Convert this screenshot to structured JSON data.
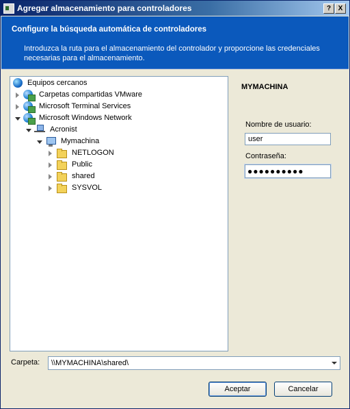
{
  "window": {
    "title": "Agregar almacenamiento para controladores",
    "help_label": "?",
    "close_label": "X"
  },
  "header": {
    "title": "Configure la búsqueda automática de controladores",
    "description": "Introduzca la ruta para el almacenamiento del controlador y proporcione las credenciales necesarias para el almacenamiento."
  },
  "tree": {
    "items": [
      {
        "label": "Equipos cercanos",
        "icon": "globe-icon",
        "expander": "none"
      },
      {
        "label": "Carpetas compartidas VMware",
        "icon": "network-globe-icon",
        "expander": "collapsed"
      },
      {
        "label": "Microsoft Terminal Services",
        "icon": "network-globe-icon",
        "expander": "collapsed"
      },
      {
        "label": "Microsoft Windows Network",
        "icon": "network-globe-icon",
        "expander": "expanded"
      },
      {
        "label": "Acronist",
        "icon": "workgroup-icon",
        "expander": "expanded"
      },
      {
        "label": "Mymachina",
        "icon": "computer-icon",
        "expander": "expanded"
      },
      {
        "label": "NETLOGON",
        "icon": "shared-folder-icon",
        "expander": "collapsed"
      },
      {
        "label": "Public",
        "icon": "shared-folder-icon",
        "expander": "collapsed"
      },
      {
        "label": "shared",
        "icon": "shared-folder-icon",
        "expander": "collapsed"
      },
      {
        "label": "SYSVOL",
        "icon": "shared-folder-icon",
        "expander": "collapsed"
      }
    ]
  },
  "credentials": {
    "machine_name": "MYMACHINA",
    "username_label": "Nombre de usuario:",
    "username_value": "user",
    "password_label": "Contraseña:",
    "password_mask": "●●●●●●●●●●"
  },
  "path": {
    "label": "Carpeta:",
    "value": "\\\\MYMACHINA\\shared\\"
  },
  "buttons": {
    "ok": "Aceptar",
    "cancel": "Cancelar"
  }
}
